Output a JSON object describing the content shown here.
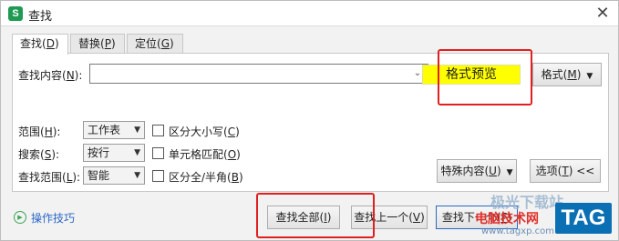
{
  "window": {
    "app_icon": "S",
    "title": "查找",
    "close_symbol": "✕"
  },
  "tabs": [
    {
      "label": "查找(",
      "key": "D",
      "end": ")"
    },
    {
      "label": "替换(",
      "key": "P",
      "end": ")"
    },
    {
      "label": "定位(",
      "key": "G",
      "end": ")"
    }
  ],
  "find": {
    "label": "查找内容(",
    "key": "N",
    "end": "):",
    "value": "",
    "arrow": "⌄"
  },
  "format_preview": {
    "text": "格式预览"
  },
  "format_button": {
    "label": "格式(",
    "key": "M",
    "end": ")",
    "caret": "▼"
  },
  "options": {
    "scope": {
      "label": "范围(",
      "key": "H",
      "end": "):",
      "value": "工作表"
    },
    "search": {
      "label": "搜索(",
      "key": "S",
      "end": "):",
      "value": "按行"
    },
    "look_in": {
      "label": "查找范围(",
      "key": "L",
      "end": "):",
      "value": "智能"
    },
    "match_case": {
      "label": "区分大小写(",
      "key": "C",
      "end": ")",
      "checked": false
    },
    "match_cell": {
      "label": "单元格匹配(",
      "key": "O",
      "end": ")",
      "checked": false
    },
    "match_width": {
      "label": "区分全/半角(",
      "key": "B",
      "end": ")",
      "checked": false
    }
  },
  "special_button": {
    "label": "特殊内容(",
    "key": "U",
    "end": ")",
    "caret": "▼"
  },
  "options_button": {
    "label": "选项(",
    "key": "T",
    "end": ") <<"
  },
  "bottom": {
    "tips": "操作技巧",
    "find_all": {
      "label": "查找全部(",
      "key": "I",
      "end": ")"
    },
    "find_prev": {
      "label": "查找上一个(",
      "key": "V",
      "end": ")"
    },
    "find_next": {
      "label": "查找下一个(",
      "key": "F",
      "end": ")"
    }
  },
  "watermark": {
    "line1": "极光下载站",
    "line2": "电脑技术网",
    "line3": "www.tagxp.com",
    "tag": "TAG"
  },
  "colors": {
    "highlight": "#ffff00",
    "annotation": "#e02020",
    "link": "#2a68c5",
    "app_green": "#1e9a53"
  }
}
